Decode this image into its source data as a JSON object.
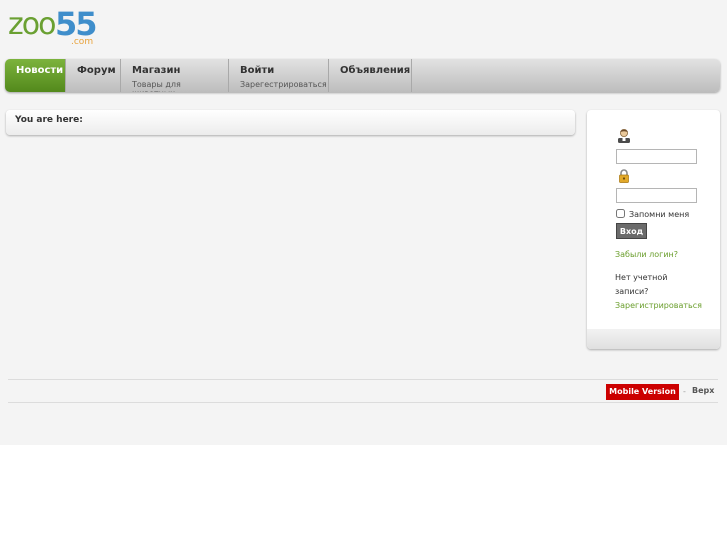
{
  "logo": {
    "main": "zoo",
    "number": "55",
    "domain": ".com"
  },
  "nav": {
    "items": [
      {
        "title": "Новости",
        "subtitle": ""
      },
      {
        "title": "Форум",
        "subtitle": ""
      },
      {
        "title": "Магазин",
        "subtitle": "Товары для животных"
      },
      {
        "title": "Войти",
        "subtitle": "Зарегестрироваться"
      },
      {
        "title": "Объявления",
        "subtitle": ""
      }
    ],
    "active_index": 0
  },
  "breadcrumb": {
    "label": "You are here:"
  },
  "login": {
    "username_value": "",
    "password_value": "",
    "remember_label": "Запомни меня",
    "remember_checked": false,
    "submit_label": "Вход",
    "forgot_link": "Забыли логин?",
    "no_account_text": "Нет учетной записи?",
    "register_link": "Зарегистрироваться"
  },
  "footer": {
    "mobile_label": "Mobile Version",
    "separator": "-",
    "top_link": "Верх"
  },
  "colors": {
    "accent_green": "#6aa032",
    "logo_blue": "#3f8ecb",
    "mobile_red": "#cc0000"
  }
}
